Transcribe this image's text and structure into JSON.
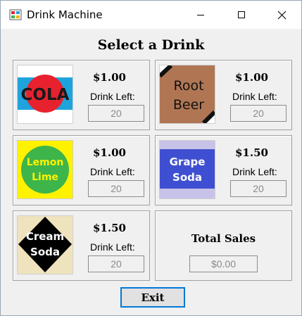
{
  "window": {
    "title": "Drink Machine"
  },
  "heading": "Select a Drink",
  "drinks": [
    {
      "name_lines": [
        "COLA"
      ],
      "price": "$1.00",
      "left_label": "Drink Left:",
      "left_value": "20",
      "icon": "cola-logo"
    },
    {
      "name_lines": [
        "Root",
        "Beer"
      ],
      "price": "$1.00",
      "left_label": "Drink Left:",
      "left_value": "20",
      "icon": "root-beer-logo"
    },
    {
      "name_lines": [
        "Lemon",
        "Lime"
      ],
      "price": "$1.00",
      "left_label": "Drink Left:",
      "left_value": "20",
      "icon": "lemon-lime-logo"
    },
    {
      "name_lines": [
        "Grape",
        "Soda"
      ],
      "price": "$1.50",
      "left_label": "Drink Left:",
      "left_value": "20",
      "icon": "grape-soda-logo"
    },
    {
      "name_lines": [
        "Cream",
        "Soda"
      ],
      "price": "$1.50",
      "left_label": "Drink Left:",
      "left_value": "20",
      "icon": "cream-soda-logo"
    }
  ],
  "total": {
    "label": "Total Sales",
    "value": "$0.00"
  },
  "exit_label": "Exit",
  "colors": {
    "window_bg": "#f0f0f0",
    "focus_border": "#0078d7",
    "cola_red": "#e8212e",
    "cola_blue": "#1fa3dd",
    "root_beer_brown": "#b07654",
    "lemon_yellow": "#fff200",
    "lime_green": "#3db54a",
    "grape_blue": "#3f4fd1",
    "grape_lavender": "#c7c3e8",
    "cream_bg": "#efe3bd"
  }
}
